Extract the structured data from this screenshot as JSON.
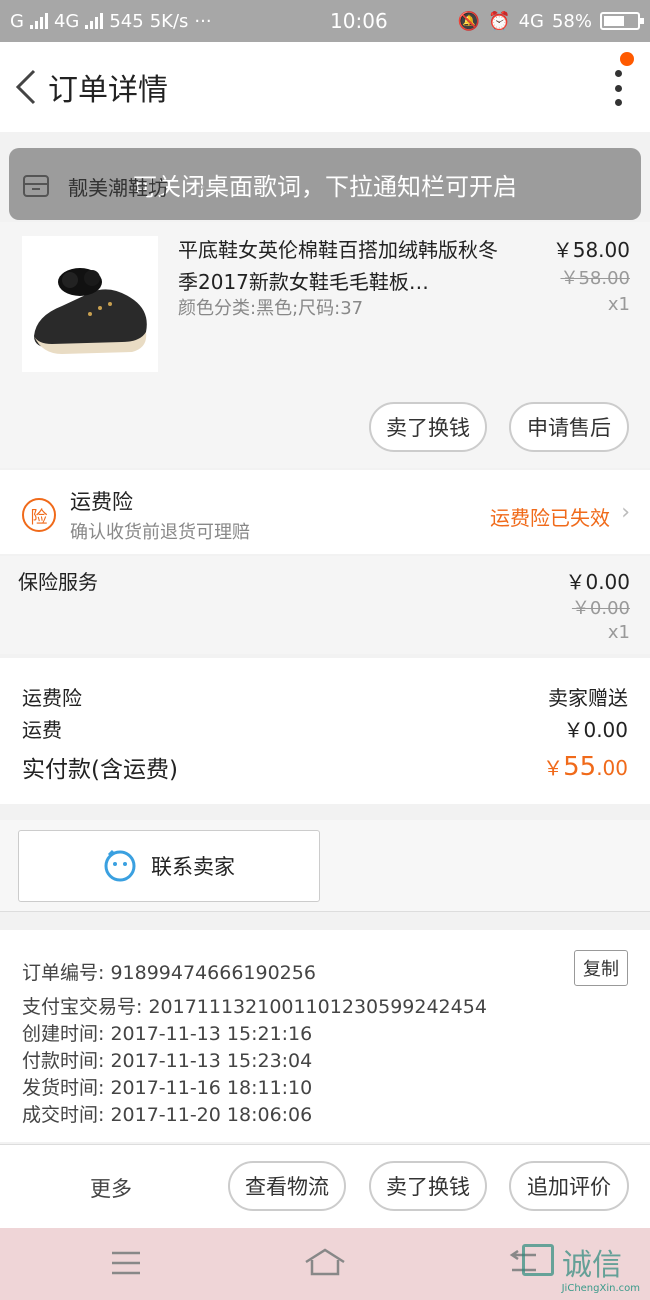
{
  "status_bar": {
    "left_text": "G",
    "network1": "4G",
    "speed_value": "545",
    "speed_unit": "5K/s",
    "ellipsis": "···",
    "time": "10:06",
    "network2": "4G",
    "battery": "58%"
  },
  "header": {
    "title": "订单详情"
  },
  "toast": {
    "text": "可关闭桌面歌词，下拉通知栏可开启"
  },
  "shop": {
    "name": "靓美潮鞋坊"
  },
  "product": {
    "title": "平底鞋女英伦棉鞋百搭加绒韩版秋冬季2017新款女鞋毛毛鞋板…",
    "sku": "颜色分类:黑色;尺码:37",
    "price": "￥58.00",
    "original_price": "￥58.00",
    "quantity": "x1",
    "buttons": {
      "exchange": "卖了换钱",
      "after_sale": "申请售后"
    }
  },
  "shipping_insurance": {
    "badge": "险",
    "title": "运费险",
    "subtitle": "确认收货前退货可理赔",
    "status": "运费险已失效"
  },
  "insurance_service": {
    "label": "保险服务",
    "price": "￥0.00",
    "original_price": "￥0.00",
    "quantity": "x1"
  },
  "summary": {
    "rows": [
      {
        "key": "运费险",
        "value": "卖家赠送"
      },
      {
        "key": "运费",
        "value": "￥0.00"
      }
    ],
    "total_label": "实付款(含运费)",
    "total_currency": "￥",
    "total_int": "55",
    "total_dec": ".00"
  },
  "contact": {
    "label": "联系卖家"
  },
  "order_info": {
    "copy_label": "复制",
    "lines": [
      "订单编号: 91899474666190256",
      "支付宝交易号: 2017111321001101230599242454",
      "创建时间: 2017-11-13  15:21:16",
      "付款时间: 2017-11-13  15:23:04",
      "发货时间: 2017-11-16  18:11:10",
      "成交时间: 2017-11-20  18:06:06"
    ]
  },
  "actions": {
    "more": "更多",
    "logistics": "查看物流",
    "exchange": "卖了换钱",
    "review": "追加评价"
  },
  "watermark": {
    "text": "诚信",
    "domain": "JiChengXin.com"
  },
  "colors": {
    "accent": "#f06a1a",
    "notify": "#ff5a00"
  }
}
